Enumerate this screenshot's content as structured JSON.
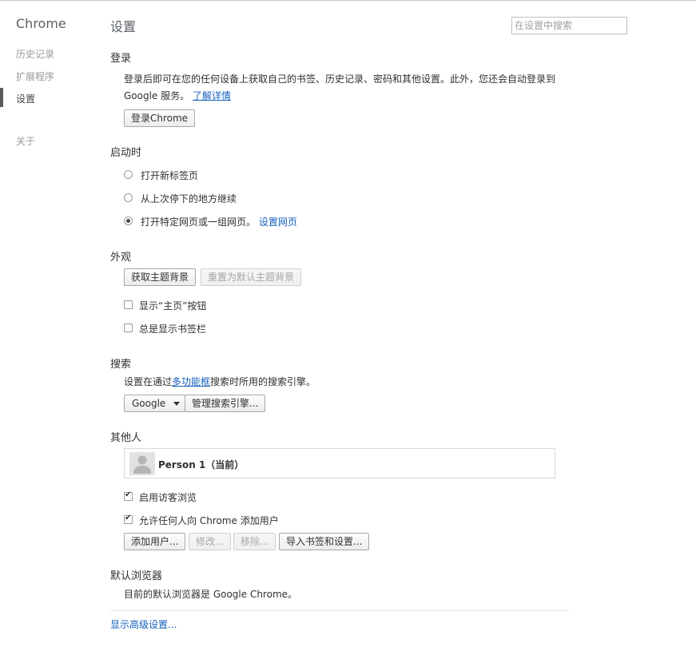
{
  "sidebar": {
    "brand": "Chrome",
    "items": [
      {
        "label": "历史记录"
      },
      {
        "label": "扩展程序"
      },
      {
        "label": "设置"
      },
      {
        "label": "关于"
      }
    ]
  },
  "header": {
    "title": "设置",
    "search_placeholder": "在设置中搜索"
  },
  "signin": {
    "title": "登录",
    "desc_line1": "登录后即可在您的任何设备上获取自己的书签、历史记录、密码和其他设置。此外，您还会自动登录到",
    "desc_line2": "Google 服务。",
    "learn_more": "了解详情",
    "button": "登录Chrome"
  },
  "startup": {
    "title": "启动时",
    "options": [
      {
        "label": "打开新标签页",
        "checked": false
      },
      {
        "label": "从上次停下的地方继续",
        "checked": false
      },
      {
        "label": "打开特定网页或一组网页。",
        "checked": true
      }
    ],
    "set_pages_link": "设置网页"
  },
  "appearance": {
    "title": "外观",
    "get_themes": "获取主题背景",
    "reset_theme": "重置为默认主题背景",
    "show_home": "显示“主页”按钮",
    "show_bookmarks": "总是显示书签栏"
  },
  "search": {
    "title": "搜索",
    "desc_prefix": "设置在通过",
    "omnibox_link": "多功能框",
    "desc_suffix": "搜索时所用的搜索引擎。",
    "engine": "Google",
    "manage": "管理搜索引擎..."
  },
  "people": {
    "title": "其他人",
    "person": "Person 1（当前）",
    "guest": "启用访客浏览",
    "allow_add": "允许任何人向 Chrome 添加用户",
    "add": "添加用户...",
    "edit": "修改...",
    "remove": "移除...",
    "import": "导入书签和设置..."
  },
  "default_browser": {
    "title": "默认浏览器",
    "desc": "目前的默认浏览器是 Google Chrome。"
  },
  "advanced_link": "显示高级设置..."
}
